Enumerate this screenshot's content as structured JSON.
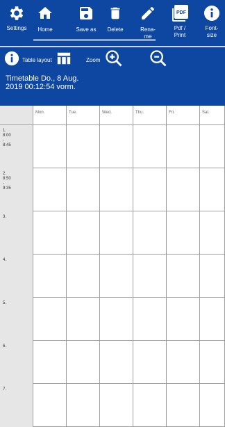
{
  "toolbar": {
    "settings_label": "Settings",
    "home_label": "Home",
    "save_label": "Save as",
    "delete_label": "Delete",
    "rename_label": "Rena-\nme",
    "pdf_label": "Pdf /\nPrint",
    "pdf_icon_text": "PDF",
    "fontsize_label": "Font-\nsize"
  },
  "toolbar2": {
    "info_label": "Table layout",
    "zoom_label": "Zoom"
  },
  "title": "Timetable Do., 8 Aug.\n2019 00:12:54 vorm.",
  "days": [
    "Mon.",
    "Tue.",
    "Wed.",
    "Thu.",
    "Fri.",
    "Sat."
  ],
  "periods": [
    {
      "label": "1.\n8:00\n-\n8:45"
    },
    {
      "label": "2.\n8:50\n-\n9:35"
    },
    {
      "label": "3."
    },
    {
      "label": "4."
    },
    {
      "label": "5."
    },
    {
      "label": "6."
    },
    {
      "label": "7."
    }
  ],
  "colors": {
    "primary": "#0d47a1",
    "header_bg": "#e6e6e6",
    "grid_line": "#9e9e9e"
  }
}
